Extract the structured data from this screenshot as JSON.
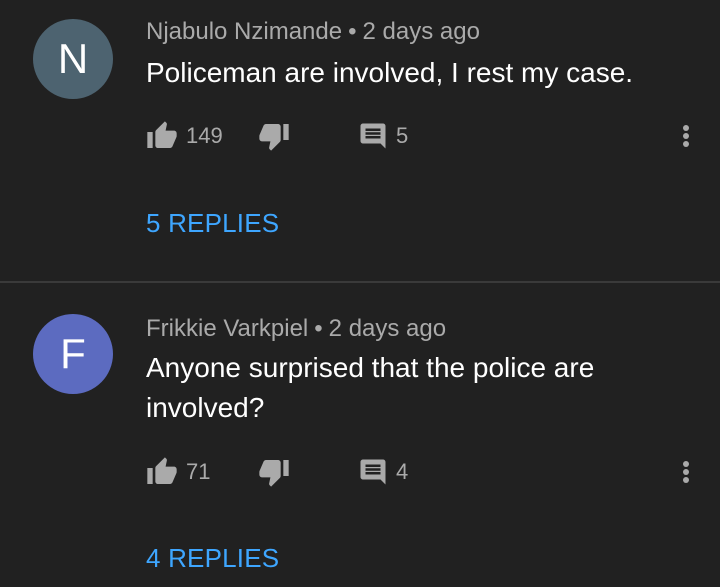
{
  "comments": [
    {
      "avatar_letter": "N",
      "avatar_color": "#4d6370",
      "author": "Njabulo Nzimande",
      "separator": "•",
      "time": "2 days ago",
      "text": "Policeman are involved, I rest my case.",
      "likes": "149",
      "replies_count": "5",
      "replies_label": "5 REPLIES"
    },
    {
      "avatar_letter": "F",
      "avatar_color": "#5c6bc0",
      "author": "Frikkie Varkpiel",
      "separator": "•",
      "time": "2 days ago",
      "text": "Anyone surprised that the police are involved?",
      "likes": "71",
      "replies_count": "4",
      "replies_label": "4 REPLIES"
    }
  ],
  "icons": {
    "like": "thumb-up-icon",
    "dislike": "thumb-down-icon",
    "reply": "comment-icon",
    "more": "more-vertical-icon"
  },
  "colors": {
    "background": "#212121",
    "link": "#3ea6ff",
    "secondary_text": "#aaaaaa"
  }
}
